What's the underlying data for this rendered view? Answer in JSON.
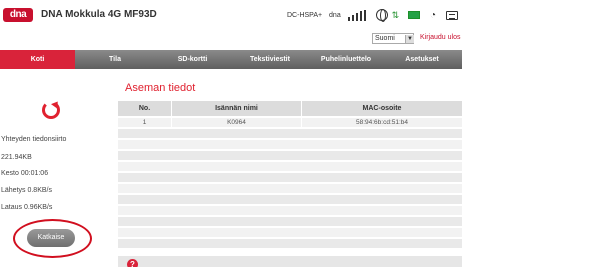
{
  "header": {
    "logo": "dna",
    "title": "DNA Mokkula 4G MF93D",
    "network_type": "DC-HSPA+",
    "operator": "dna"
  },
  "language": {
    "selected": "Suomi",
    "logout_label": "Kirjaudu ulos"
  },
  "nav": {
    "items": [
      {
        "label": "Koti",
        "active": true
      },
      {
        "label": "Tila"
      },
      {
        "label": "SD-kortti"
      },
      {
        "label": "Tekstiviestit"
      },
      {
        "label": "Puhelinluettelo"
      },
      {
        "label": "Asetukset"
      }
    ]
  },
  "sidebar": {
    "transfer_label": "Yhteyden tiedonsiirto",
    "transfer_amount": "221.94KB",
    "duration": "Kesto 00:01:06",
    "upload": "Lähetys 0.8KB/s",
    "download": "Lataus 0.96KB/s",
    "disconnect_label": "Katkaise"
  },
  "main": {
    "title": "Aseman tiedot",
    "columns": [
      "No.",
      "Isännän nimi",
      "MAC-osoite"
    ],
    "rows": [
      {
        "no": "1",
        "host": "K0964",
        "mac": "58:94:6b:cd:51:b4"
      }
    ]
  }
}
